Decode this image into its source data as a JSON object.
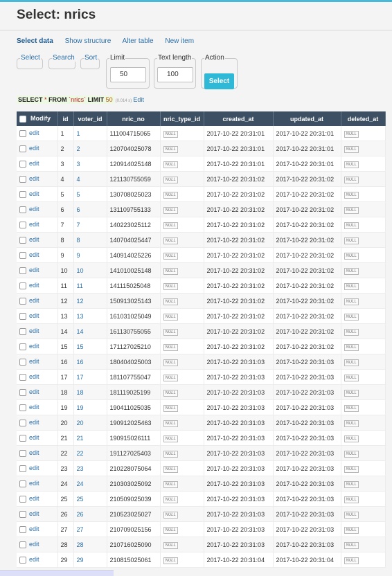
{
  "page": {
    "title": "Select: nrics"
  },
  "nav": {
    "items": [
      "Select data",
      "Show structure",
      "Alter table",
      "New item"
    ]
  },
  "controls": {
    "select_label": "Select",
    "search_label": "Search",
    "sort_label": "Sort",
    "limit_label": "Limit",
    "limit_value": "50",
    "text_length_label": "Text length",
    "text_length_value": "100",
    "action_label": "Action",
    "action_button": "Select"
  },
  "query": {
    "kw_select": "SELECT",
    "star": "*",
    "kw_from": "FROM",
    "table": "`nrics`",
    "kw_limit": "LIMIT",
    "limit": "50",
    "time": "(0.014 s)",
    "edit": "Edit"
  },
  "table": {
    "columns": [
      "Modify",
      "id",
      "voter_id",
      "nric_no",
      "nric_type_id",
      "created_at",
      "updated_at",
      "deleted_at"
    ],
    "edit_label": "edit",
    "null_label": "NULL",
    "rows": [
      [
        "1",
        "1",
        "111004715065",
        "2017-10-22 20:31:01",
        "2017-10-22 20:31:01"
      ],
      [
        "2",
        "2",
        "120704025078",
        "2017-10-22 20:31:01",
        "2017-10-22 20:31:01"
      ],
      [
        "3",
        "3",
        "120914025148",
        "2017-10-22 20:31:01",
        "2017-10-22 20:31:01"
      ],
      [
        "4",
        "4",
        "121130755059",
        "2017-10-22 20:31:02",
        "2017-10-22 20:31:02"
      ],
      [
        "5",
        "5",
        "130708025023",
        "2017-10-22 20:31:02",
        "2017-10-22 20:31:02"
      ],
      [
        "6",
        "6",
        "131109755133",
        "2017-10-22 20:31:02",
        "2017-10-22 20:31:02"
      ],
      [
        "7",
        "7",
        "140223025112",
        "2017-10-22 20:31:02",
        "2017-10-22 20:31:02"
      ],
      [
        "8",
        "8",
        "140704025447",
        "2017-10-22 20:31:02",
        "2017-10-22 20:31:02"
      ],
      [
        "9",
        "9",
        "140914025226",
        "2017-10-22 20:31:02",
        "2017-10-22 20:31:02"
      ],
      [
        "10",
        "10",
        "141010025148",
        "2017-10-22 20:31:02",
        "2017-10-22 20:31:02"
      ],
      [
        "11",
        "11",
        "141115025048",
        "2017-10-22 20:31:02",
        "2017-10-22 20:31:02"
      ],
      [
        "12",
        "12",
        "150913025143",
        "2017-10-22 20:31:02",
        "2017-10-22 20:31:02"
      ],
      [
        "13",
        "13",
        "161031025049",
        "2017-10-22 20:31:02",
        "2017-10-22 20:31:02"
      ],
      [
        "14",
        "14",
        "161130755055",
        "2017-10-22 20:31:02",
        "2017-10-22 20:31:02"
      ],
      [
        "15",
        "15",
        "171127025210",
        "2017-10-22 20:31:02",
        "2017-10-22 20:31:02"
      ],
      [
        "16",
        "16",
        "180404025003",
        "2017-10-22 20:31:03",
        "2017-10-22 20:31:03"
      ],
      [
        "17",
        "17",
        "181107755047",
        "2017-10-22 20:31:03",
        "2017-10-22 20:31:03"
      ],
      [
        "18",
        "18",
        "181119025199",
        "2017-10-22 20:31:03",
        "2017-10-22 20:31:03"
      ],
      [
        "19",
        "19",
        "190411025035",
        "2017-10-22 20:31:03",
        "2017-10-22 20:31:03"
      ],
      [
        "20",
        "20",
        "190912025463",
        "2017-10-22 20:31:03",
        "2017-10-22 20:31:03"
      ],
      [
        "21",
        "21",
        "190915026111",
        "2017-10-22 20:31:03",
        "2017-10-22 20:31:03"
      ],
      [
        "22",
        "22",
        "191127025403",
        "2017-10-22 20:31:03",
        "2017-10-22 20:31:03"
      ],
      [
        "23",
        "23",
        "210228075064",
        "2017-10-22 20:31:03",
        "2017-10-22 20:31:03"
      ],
      [
        "24",
        "24",
        "210303025092",
        "2017-10-22 20:31:03",
        "2017-10-22 20:31:03"
      ],
      [
        "25",
        "25",
        "210509025039",
        "2017-10-22 20:31:03",
        "2017-10-22 20:31:03"
      ],
      [
        "26",
        "26",
        "210523025027",
        "2017-10-22 20:31:03",
        "2017-10-22 20:31:03"
      ],
      [
        "27",
        "27",
        "210709025156",
        "2017-10-22 20:31:03",
        "2017-10-22 20:31:03"
      ],
      [
        "28",
        "28",
        "210716025090",
        "2017-10-22 20:31:03",
        "2017-10-22 20:31:03"
      ],
      [
        "29",
        "29",
        "210815025061",
        "2017-10-22 20:31:04",
        "2017-10-22 20:31:04"
      ]
    ]
  }
}
